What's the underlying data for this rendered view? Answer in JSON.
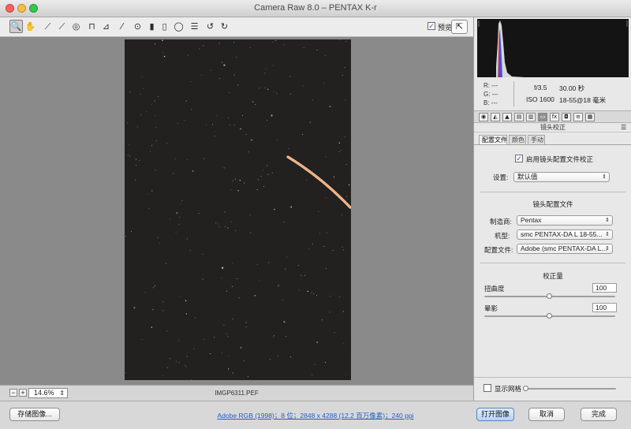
{
  "window": {
    "title": "Camera Raw 8.0 –  PENTAX K-r",
    "traffic_colors": [
      "#fc605c",
      "#fdbc40",
      "#34c84a"
    ]
  },
  "toolbar": {
    "tools": [
      {
        "name": "zoom-tool",
        "icon": "magnifier-icon",
        "glyph": "🔍",
        "active": true
      },
      {
        "name": "hand-tool",
        "icon": "hand-icon",
        "glyph": "✋",
        "active": false
      },
      {
        "name": "white-balance-tool",
        "icon": "eyedropper-icon",
        "glyph": "⟋",
        "active": false
      },
      {
        "name": "color-sampler-tool",
        "icon": "sampler-icon",
        "glyph": "⟋",
        "active": false
      },
      {
        "name": "targeted-adjustment-tool",
        "icon": "target-icon",
        "glyph": "◎",
        "active": false
      },
      {
        "name": "crop-tool",
        "icon": "crop-icon",
        "glyph": "⊓",
        "active": false
      },
      {
        "name": "straighten-tool",
        "icon": "straighten-icon",
        "glyph": "⊿",
        "active": false
      },
      {
        "name": "spot-removal-tool",
        "icon": "brush-icon",
        "glyph": "⁄",
        "active": false
      },
      {
        "name": "red-eye-tool",
        "icon": "eye-icon",
        "glyph": "⊙",
        "active": false
      },
      {
        "name": "adjustment-brush-tool",
        "icon": "brush-icon",
        "glyph": "▮",
        "active": false
      },
      {
        "name": "graduated-filter-tool",
        "icon": "graduated-filter-icon",
        "glyph": "▯",
        "active": false
      },
      {
        "name": "radial-filter-tool",
        "icon": "radial-filter-icon",
        "glyph": "◯",
        "active": false
      },
      {
        "name": "preferences-tool",
        "icon": "list-icon",
        "glyph": "☰",
        "active": false
      },
      {
        "name": "rotate-left-tool",
        "icon": "rotate-ccw-icon",
        "glyph": "↺",
        "active": false
      },
      {
        "name": "rotate-right-tool",
        "icon": "rotate-cw-icon",
        "glyph": "↻",
        "active": false
      }
    ],
    "preview_label": "预览",
    "preview_checked": true
  },
  "status": {
    "zoom_value": "14.6%",
    "filename": "IMGP6311.PEF"
  },
  "readout": {
    "r_label": "R:",
    "r_value": "---",
    "g_label": "G:",
    "g_value": "---",
    "b_label": "B:",
    "b_value": "---",
    "aperture": "f/3.5",
    "shutter": "30.00 秒",
    "iso": "ISO 1600",
    "lens": "18-55@18 毫米"
  },
  "panel": {
    "tab_icons": [
      "aperture-icon",
      "tone-curve-icon",
      "detail-icon",
      "hsl-icon",
      "split-tone-icon",
      "lens-icon",
      "fx-icon",
      "camera-icon",
      "presets-icon",
      "snapshot-icon"
    ],
    "tab_glyphs": [
      "◉",
      "◭",
      "▲",
      "▤",
      "▥",
      "▭",
      "fx",
      "◘",
      "≡",
      "▦"
    ],
    "section_title": "镜头校正",
    "subtabs": [
      "配置文件",
      "颜色",
      "手动"
    ],
    "enable_profile_label": "启用镜头配置文件校正",
    "setup_label": "设置:",
    "setup_value": "默认值",
    "lens_profile_title": "镜头配置文件",
    "make_label": "制造商:",
    "make_value": "Pentax",
    "model_label": "机型:",
    "model_value": "smc PENTAX-DA L 18-55...",
    "profile_label": "配置文件:",
    "profile_value": "Adobe (smc PENTAX-DA L...",
    "correction_title": "校正量",
    "distortion_label": "扭曲度",
    "distortion_value": "100",
    "vignetting_label": "晕影",
    "vignetting_value": "100",
    "grid_label": "显示网格"
  },
  "bottom": {
    "save_label": "存储图像...",
    "info_link": "Adobe RGB (1998)；8 位；2848 x 4288 (12.2 百万像素)；240 ppi",
    "open_label": "打开图像",
    "cancel_label": "取消",
    "done_label": "完成"
  }
}
